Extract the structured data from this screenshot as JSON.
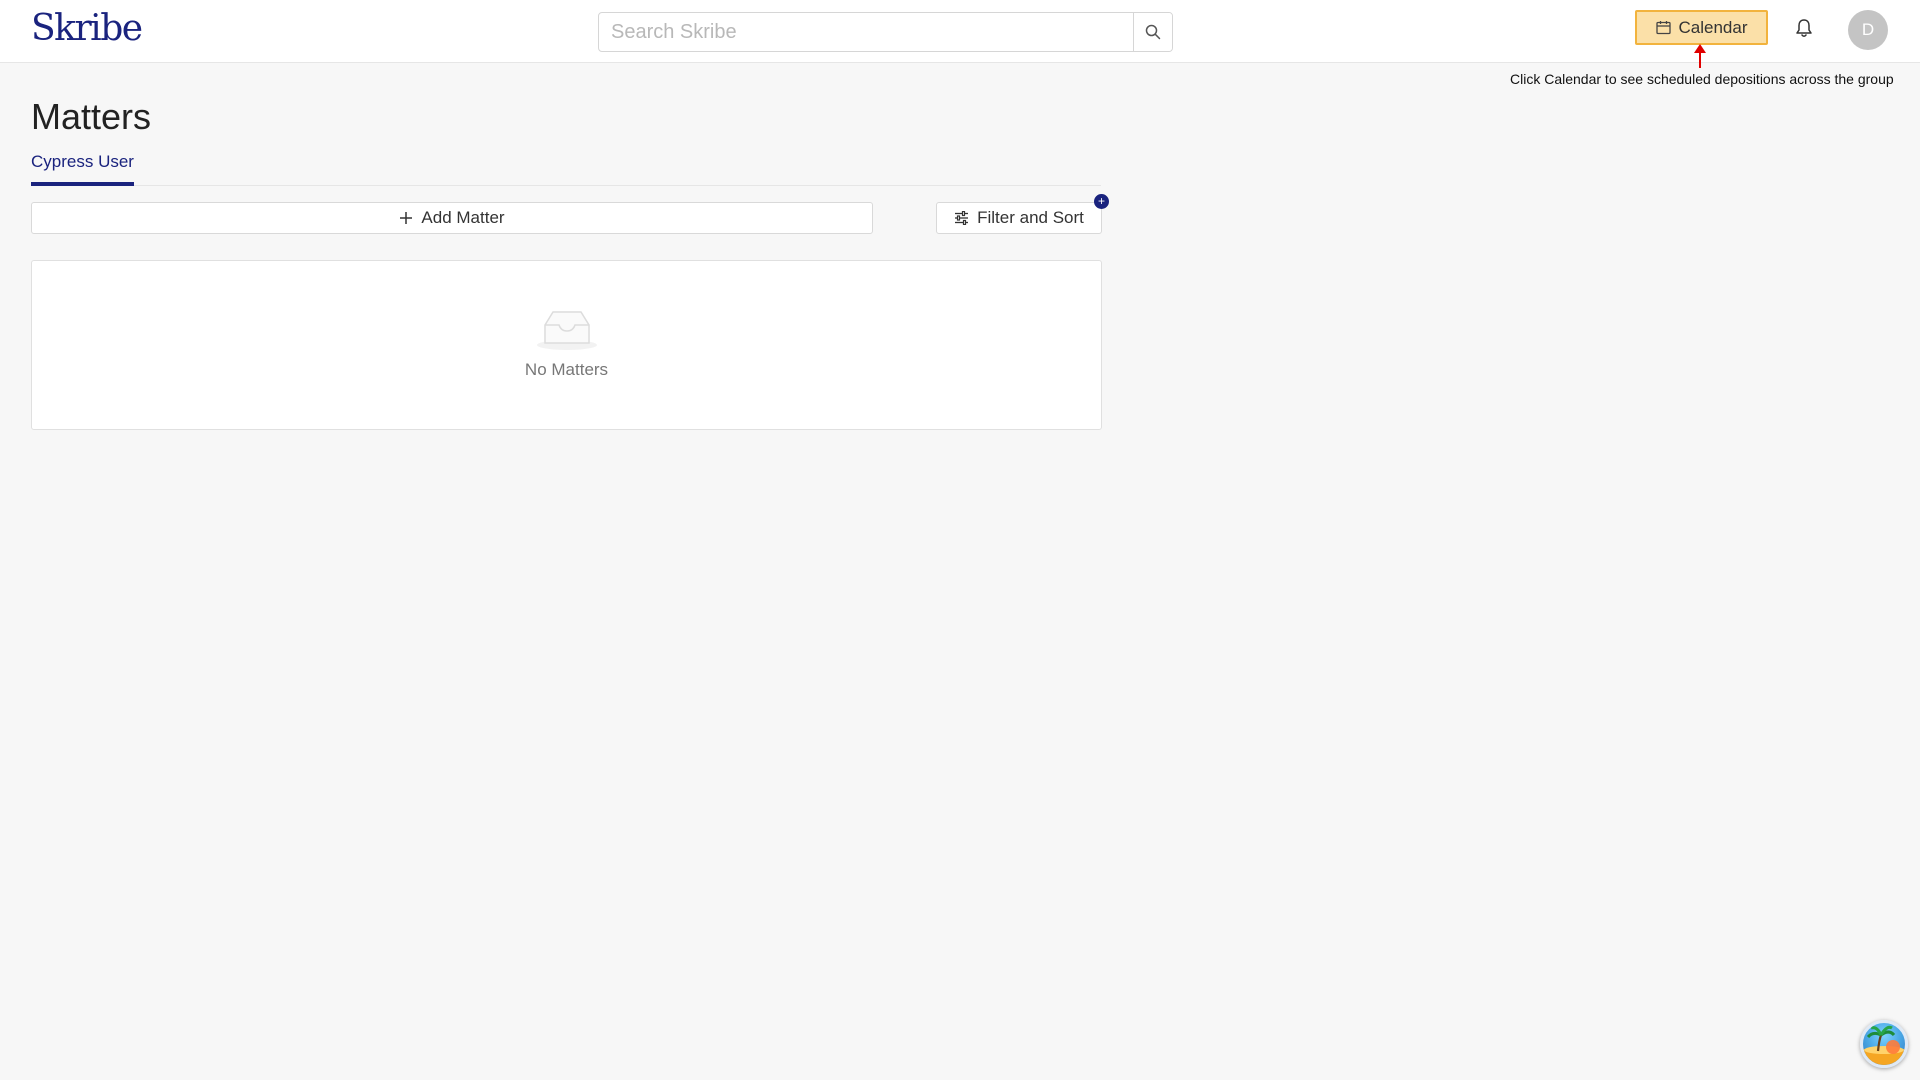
{
  "header": {
    "logo": "Skribe",
    "search_placeholder": "Search Skribe",
    "calendar_label": "Calendar",
    "avatar_initial": "D"
  },
  "hint": {
    "text": "Click Calendar to see scheduled depositions across the group"
  },
  "main": {
    "title": "Matters",
    "tabs": [
      {
        "label": "Cypress User",
        "active": true
      }
    ],
    "add_matter_label": "Add Matter",
    "filter_label": "Filter and Sort",
    "filter_badge": "+",
    "empty_text": "No Matters"
  },
  "colors": {
    "brand": "#1a237e",
    "calendar_highlight_fill": "#fbe0a8",
    "calendar_highlight_border": "#f2b33d",
    "hint_arrow": "#e00000"
  },
  "icons": {
    "search": "search-icon",
    "calendar": "calendar-icon",
    "bell": "bell-icon",
    "plus": "plus-icon",
    "filter": "sliders-icon",
    "empty": "inbox-icon",
    "assistant": "palm-tree-icon"
  }
}
